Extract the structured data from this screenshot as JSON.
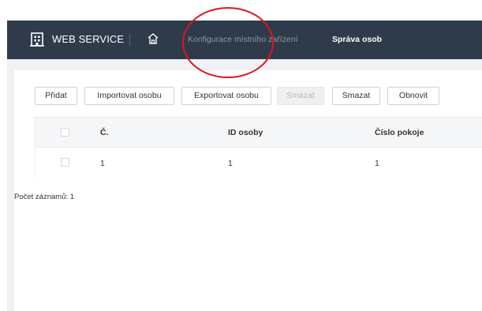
{
  "header": {
    "brand": "WEB SERVICE",
    "nav": {
      "local_config": "Konfigurace místního zařízení",
      "person_management": "Správa osob"
    }
  },
  "toolbar": {
    "add": "Přidat",
    "import": "Importovat osobu",
    "export": "Exportovat osobu",
    "delete_disabled": "Smazat",
    "delete": "Smazat",
    "refresh": "Obnovit"
  },
  "table": {
    "columns": [
      "Č.",
      "ID osoby",
      "Číslo pokoje"
    ],
    "rows": [
      {
        "no": "1",
        "person_id": "1",
        "room_no": "1"
      }
    ]
  },
  "footer": {
    "record_count": "Počet záznamů: 1"
  },
  "colors": {
    "topbar": "#2f3b4b",
    "annotation_circle": "#e0141e"
  },
  "icons": [
    "building-logo-icon",
    "home-icon",
    "checkbox-icon"
  ]
}
